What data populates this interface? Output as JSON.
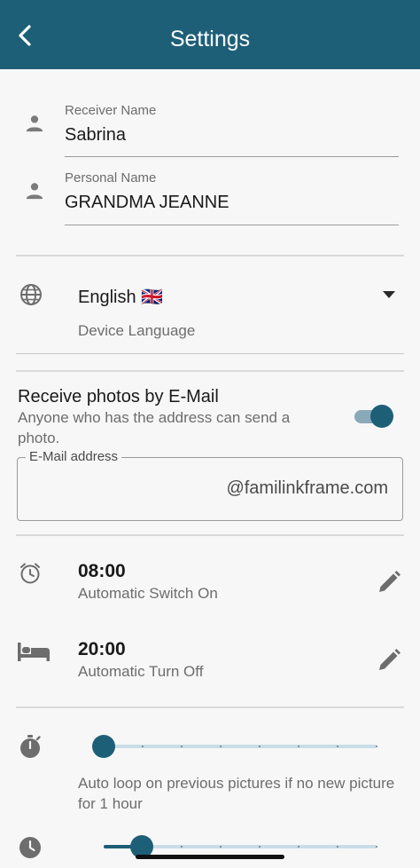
{
  "header": {
    "title": "Settings",
    "back_icon": "chevron-left-icon"
  },
  "receiver": {
    "label": "Receiver Name",
    "value": "Sabrina"
  },
  "personal": {
    "label": "Personal Name",
    "value": "GRANDMA JEANNE"
  },
  "language": {
    "value": "English 🇬🇧",
    "caption": "Device Language"
  },
  "email": {
    "title": "Receive photos by E-Mail",
    "description": "Anyone who has the address can send a photo.",
    "toggle_on": true,
    "field_label": "E-Mail address",
    "field_value": "@familinkframe.com"
  },
  "switch_on": {
    "time": "08:00",
    "caption": "Automatic Switch On"
  },
  "turn_off": {
    "time": "20:00",
    "caption": "Automatic Turn Off"
  },
  "auto_loop": {
    "caption": "Auto loop on previous pictures if no new picture for 1 hour",
    "level": 0
  },
  "second_slider": {
    "level": 0.14
  },
  "colors": {
    "primary": "#1e5f78",
    "background": "#f7f7f7"
  }
}
